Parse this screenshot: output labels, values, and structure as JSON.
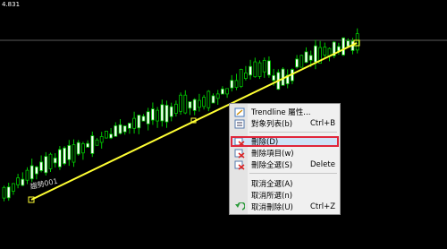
{
  "chart": {
    "price_label": "4.831",
    "trendline_name": "趨勢001",
    "colors": {
      "background": "#000000",
      "candle": "#00c800",
      "candle_up_fill": "#000000",
      "candle_down_fill": "#ffffff",
      "trendline": "#ffff33",
      "grid": "#4a4a4a"
    }
  },
  "context_menu": {
    "items": [
      {
        "label": "Trendline 屬性...",
        "shortcut": "",
        "icon": "properties-icon"
      },
      {
        "label": "對象列表(b)",
        "shortcut": "Ctrl+B",
        "icon": "object-list-icon"
      },
      {
        "label": "刪除(D)",
        "shortcut": "",
        "icon": "delete-icon",
        "highlighted": true
      },
      {
        "label": "刪除項目(w)",
        "shortcut": "",
        "icon": "delete-item-icon"
      },
      {
        "label": "刪除全選(S)",
        "shortcut": "Delete",
        "icon": "delete-selected-icon"
      },
      {
        "label": "取消全選(A)",
        "shortcut": "",
        "icon": ""
      },
      {
        "label": "取消所選(n)",
        "shortcut": "",
        "icon": ""
      },
      {
        "label": "取消刪除(U)",
        "shortcut": "Ctrl+Z",
        "icon": "undo-icon"
      }
    ],
    "highlight_color": "#e0263a"
  }
}
